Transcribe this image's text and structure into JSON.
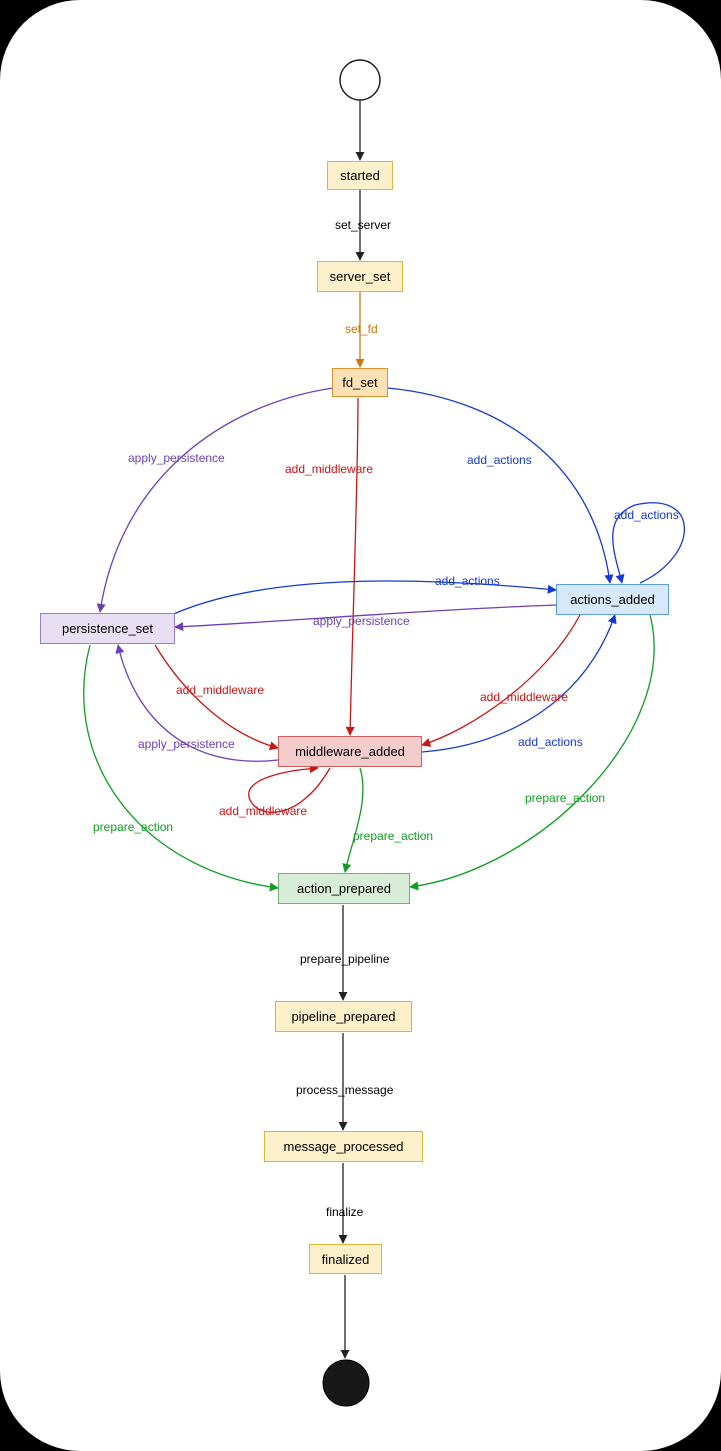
{
  "nodes": {
    "started": "started",
    "server_set": "server_set",
    "fd_set": "fd_set",
    "persistence_set": "persistence_set",
    "actions_added": "actions_added",
    "middleware_added": "middleware_added",
    "action_prepared": "action_prepared",
    "pipeline_prepared": "pipeline_prepared",
    "message_processed": "message_processed",
    "finalized": "finalized"
  },
  "edges": {
    "set_server": "set_server",
    "set_fd": "set_fd",
    "apply_persistence": "apply_persistence",
    "add_middleware": "add_middleware",
    "add_actions": "add_actions",
    "prepare_action": "prepare_action",
    "prepare_pipeline": "prepare_pipeline",
    "process_message": "process_message",
    "finalize": "finalize"
  },
  "colors": {
    "yellow_fill": "#fbf0c9",
    "yellow_border": "#d9b73a",
    "orange_fill": "#fde1b4",
    "orange_border": "#e0912f",
    "purple_fill": "#e8dff5",
    "purple_border": "#9b7cc7",
    "blue_fill": "#d6e8fa",
    "blue_border": "#5a9de0",
    "red_fill": "#f5cccc",
    "red_border": "#d06060",
    "green_fill": "#d8edd8",
    "green_border": "#6fb06f",
    "edge_black": "#222222",
    "edge_orange": "#d07900",
    "edge_purple": "#6b3fb5",
    "edge_red": "#cc1414",
    "edge_blue": "#1439d6",
    "edge_green": "#0e9e20"
  }
}
